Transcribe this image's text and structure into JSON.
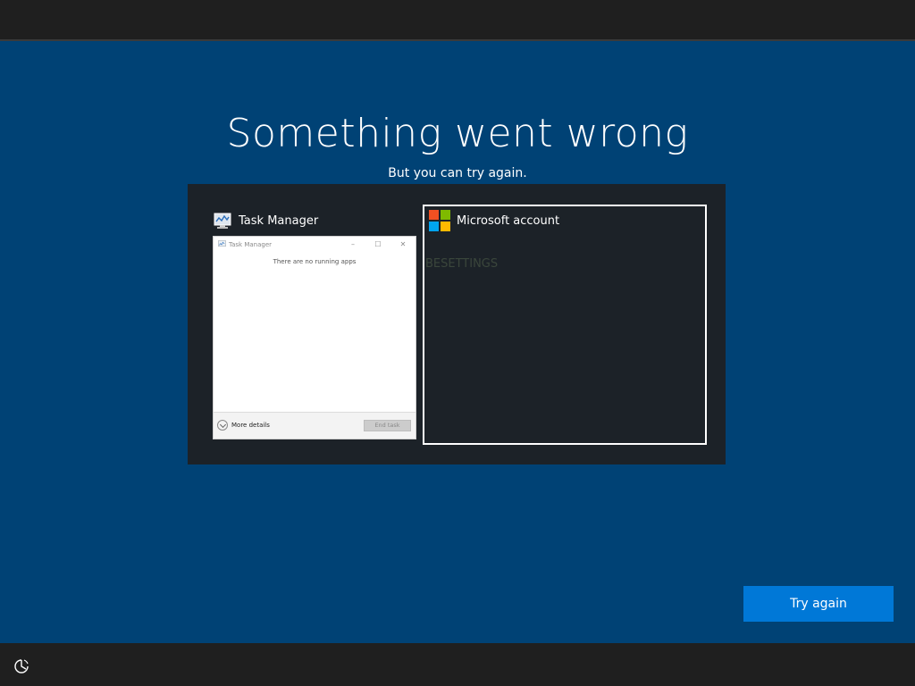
{
  "header": {
    "title": "Something went wrong",
    "subtitle": "But you can try again."
  },
  "switcher": {
    "task_manager": {
      "label": "Task Manager",
      "icon": "task-manager-icon",
      "window": {
        "title": "Task Manager",
        "minimize_glyph": "–",
        "maximize_glyph": "☐",
        "close_glyph": "✕",
        "empty_message": "There are no running apps",
        "more_details_label": "More details",
        "end_task_label": "End task"
      }
    },
    "microsoft_account": {
      "label": "Microsoft account",
      "icon": "microsoft-logo-icon",
      "background_text": "BESETTINGS"
    }
  },
  "actions": {
    "try_again_label": "Try again"
  },
  "footer": {
    "ease_of_access_icon": "ease-of-access-icon"
  },
  "colors": {
    "background": "#004275",
    "bar": "#1f1f1f",
    "panel": "#1c2228",
    "accent": "#0078d7",
    "ms_red": "#f25022",
    "ms_green": "#7fba00",
    "ms_blue": "#00a4ef",
    "ms_yellow": "#ffb900"
  }
}
